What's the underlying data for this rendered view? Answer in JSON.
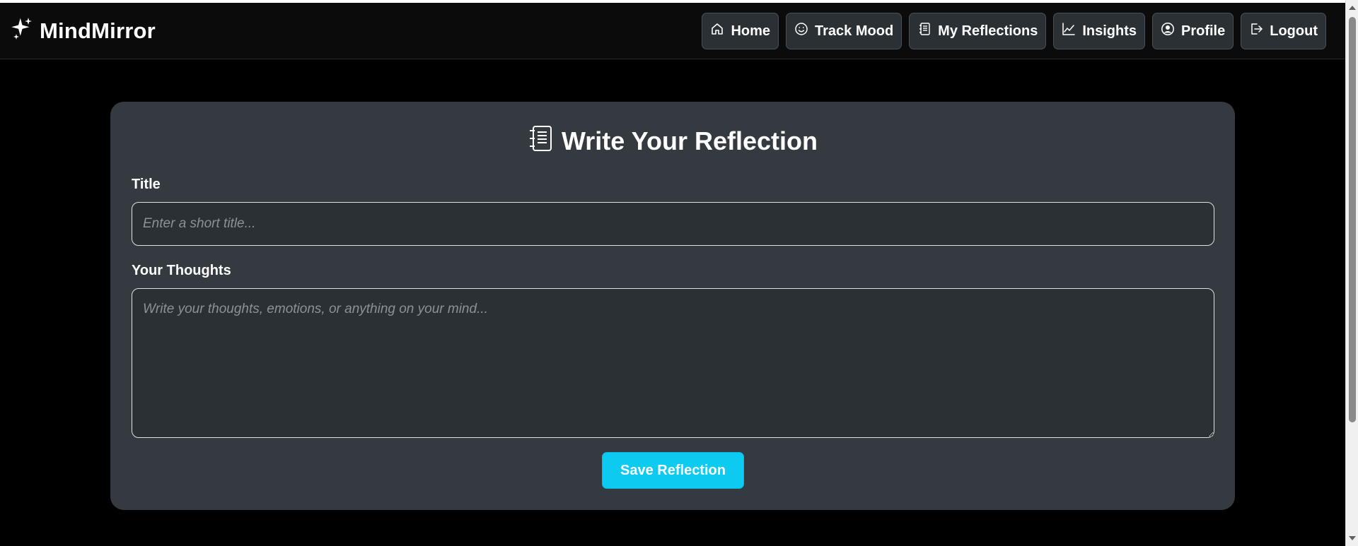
{
  "app": {
    "brand_name": "MindMirror",
    "brand_icon": "sparkles-icon"
  },
  "nav": {
    "items": [
      {
        "label": "Home",
        "icon": "house-icon"
      },
      {
        "label": "Track Mood",
        "icon": "smiley-icon"
      },
      {
        "label": "My Reflections",
        "icon": "journal-icon"
      },
      {
        "label": "Insights",
        "icon": "line-chart-icon"
      },
      {
        "label": "Profile",
        "icon": "person-circle-icon"
      },
      {
        "label": "Logout",
        "icon": "logout-icon"
      }
    ]
  },
  "form": {
    "heading": "Write Your Reflection",
    "heading_icon": "journal-icon",
    "title_label": "Title",
    "title_placeholder": "Enter a short title...",
    "title_value": "",
    "thoughts_label": "Your Thoughts",
    "thoughts_placeholder": "Write your thoughts, emotions, or anything on your mind...",
    "thoughts_value": "",
    "save_label": "Save Reflection"
  },
  "colors": {
    "page_background": "#000000",
    "navbar_background": "#0b0b0b",
    "card_background": "#343a40",
    "input_background": "#2b3035",
    "accent": "#0dcaf0"
  }
}
